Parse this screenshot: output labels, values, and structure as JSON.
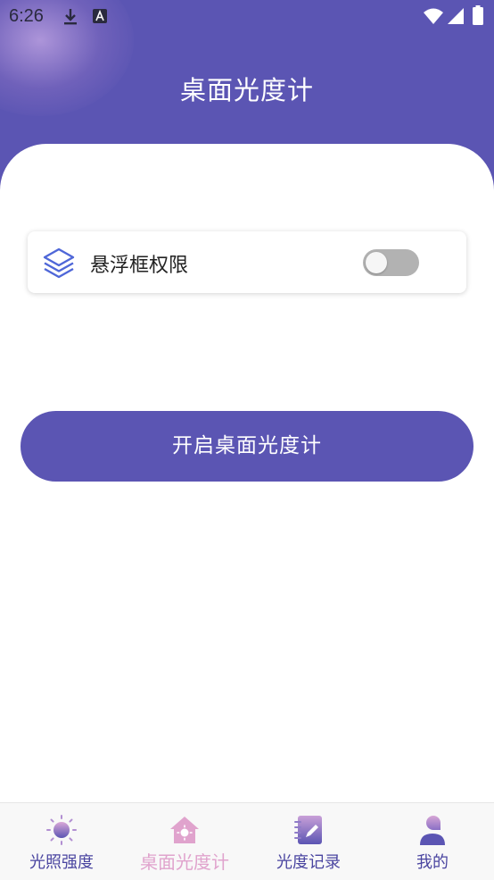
{
  "status_bar": {
    "time": "6:26",
    "icons": [
      "download-icon",
      "a-icon",
      "wifi-icon",
      "signal-icon",
      "battery-icon"
    ]
  },
  "header": {
    "title": "桌面光度计",
    "background_color": "#5b55b3"
  },
  "permission": {
    "icon": "layers-icon",
    "label": "悬浮框权限",
    "toggle_on": false
  },
  "start_button": {
    "label": "开启桌面光度计"
  },
  "bottom_nav": {
    "items": [
      {
        "label": "光照强度",
        "icon": "sun-icon",
        "active": false
      },
      {
        "label": "桌面光度计",
        "icon": "house-sun-icon",
        "active": true
      },
      {
        "label": "光度记录",
        "icon": "notebook-pen-icon",
        "active": false
      },
      {
        "label": "我的",
        "icon": "user-icon",
        "active": false
      }
    ]
  },
  "colors": {
    "primary": "#5b55b3",
    "active_tab": "#e0a3cd",
    "inactive_tab": "#4a45a0"
  }
}
